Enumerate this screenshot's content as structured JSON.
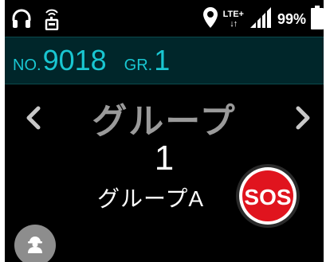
{
  "status_bar": {
    "left_icons": [
      "headset-icon",
      "walkie-talkie-icon"
    ],
    "location_icon": "location-pin-icon",
    "network_label": "LTE+",
    "network_arrows": "↓↑",
    "signal_icon": "signal-bars-icon",
    "battery_percent": "99%",
    "battery_icon": "battery-icon"
  },
  "header": {
    "no_label": "NO.",
    "no_value": "9018",
    "gr_label": "GR.",
    "gr_value": "1",
    "accent_color": "#19c6d1",
    "background_color": "#00262a"
  },
  "main": {
    "title": "グループ",
    "group_number": "1",
    "group_name": "グループA",
    "prev_icon": "chevron-left-icon",
    "next_icon": "chevron-right-icon",
    "sos_label": "SOS",
    "sos_color": "#e0141e",
    "user_icon": "worker-helmet-icon"
  }
}
